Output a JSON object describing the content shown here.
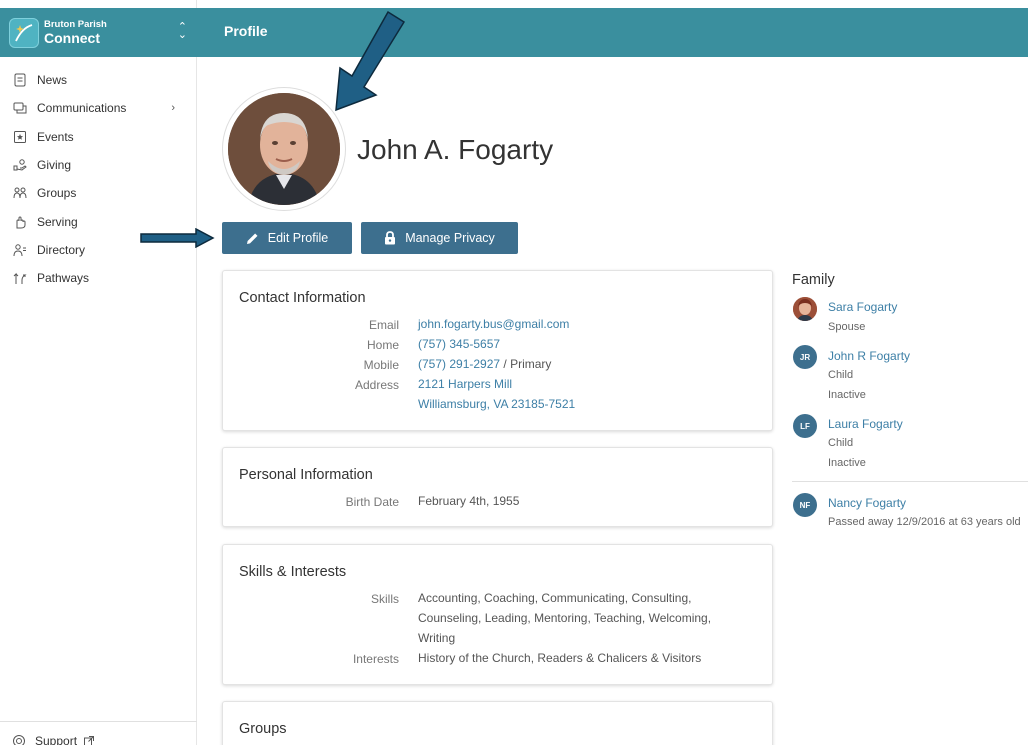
{
  "brand": {
    "small": "Bruton Parish",
    "big": "Connect"
  },
  "nav": [
    {
      "label": "News",
      "icon": "news-icon"
    },
    {
      "label": "Communications",
      "icon": "communications-icon"
    },
    {
      "label": "Events",
      "icon": "events-icon"
    },
    {
      "label": "Giving",
      "icon": "giving-icon"
    },
    {
      "label": "Groups",
      "icon": "groups-icon"
    },
    {
      "label": "Serving",
      "icon": "serving-icon"
    },
    {
      "label": "Directory",
      "icon": "directory-icon"
    },
    {
      "label": "Pathways",
      "icon": "pathways-icon"
    }
  ],
  "support": {
    "label": "Support"
  },
  "header": {
    "title": "Profile"
  },
  "profile": {
    "name": "John A. Fogarty"
  },
  "buttons": {
    "edit": "Edit Profile",
    "privacy": "Manage Privacy"
  },
  "contact": {
    "title": "Contact Information",
    "email_label": "Email",
    "email": "john.fogarty.bus@gmail.com",
    "home_label": "Home",
    "home": "(757) 345-5657",
    "mobile_label": "Mobile",
    "mobile": "(757) 291-2927",
    "mobile_suffix": " / Primary",
    "address_label": "Address",
    "address_line1": "2121 Harpers Mill",
    "address_line2": "Williamsburg, VA 23185-7521"
  },
  "personal": {
    "title": "Personal Information",
    "birth_label": "Birth Date",
    "birth": "February 4th, 1955"
  },
  "skills": {
    "title": "Skills & Interests",
    "skills_label": "Skills",
    "skills": "Accounting, Coaching, Communicating, Consulting, Counseling, Leading, Mentoring, Teaching, Welcoming, Writing",
    "interests_label": "Interests",
    "interests": "History of the Church, Readers & Chalicers & Visitors"
  },
  "groups": {
    "title": "Groups"
  },
  "family": {
    "title": "Family",
    "members": [
      {
        "initials": "",
        "name": "Sara Fogarty",
        "relation": "Spouse",
        "status": ""
      },
      {
        "initials": "JR",
        "name": "John R Fogarty",
        "relation": "Child",
        "status": "Inactive"
      },
      {
        "initials": "LF",
        "name": "Laura Fogarty",
        "relation": "Child",
        "status": "Inactive"
      },
      {
        "initials": "NF",
        "name": "Nancy Fogarty",
        "relation": "Passed away 12/9/2016 at 63 years old",
        "status": ""
      }
    ]
  },
  "colors": {
    "brand": "#3a8f9e",
    "button": "#3d6f8e",
    "link": "#3d7fa6",
    "annotation_arrow": "#1f5f85"
  }
}
